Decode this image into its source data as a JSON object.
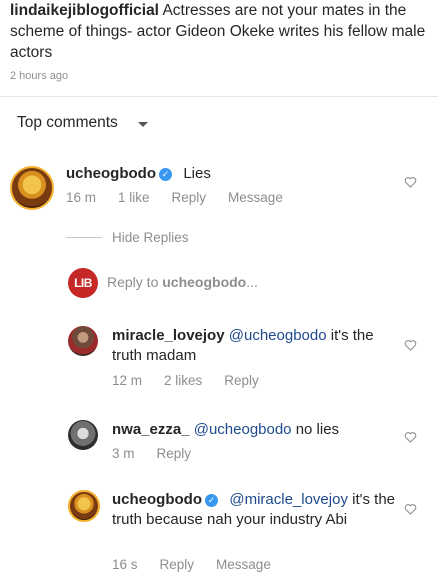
{
  "post": {
    "username": "lindaikejiblogofficial",
    "caption": "Actresses are not your mates in the scheme of things- actor Gideon Okeke writes his fellow male actors",
    "time": "2 hours ago"
  },
  "sort": {
    "label": "Top comments"
  },
  "comments": [
    {
      "username": "ucheogbodo",
      "verified": true,
      "text": "Lies",
      "time": "16 m",
      "likes": "1 like",
      "reply": "Reply",
      "message": "Message"
    }
  ],
  "hide_replies": "Hide Replies",
  "reply_input": {
    "prefix": "Reply to ",
    "user": "ucheogbodo",
    "suffix": "..."
  },
  "lib_avatar_text": "LIB",
  "replies": [
    {
      "username": "miracle_lovejoy",
      "mention": "@ucheogbodo",
      "text": " it's the truth madam",
      "time": "12 m",
      "likes": "2 likes",
      "reply": "Reply"
    },
    {
      "username": "nwa_ezza_",
      "mention": "@ucheogbodo",
      "text": " no lies",
      "time": "3 m",
      "reply": "Reply"
    },
    {
      "username": "ucheogbodo",
      "verified": true,
      "mention": "@miracle_lovejoy",
      "text": " it's the truth because nah your industry Abi",
      "time": "16 s",
      "reply": "Reply",
      "message": "Message"
    }
  ],
  "colors": {
    "mention": "#1f4b8e",
    "verified": "#3897f0",
    "muted": "#8e8e8e"
  }
}
